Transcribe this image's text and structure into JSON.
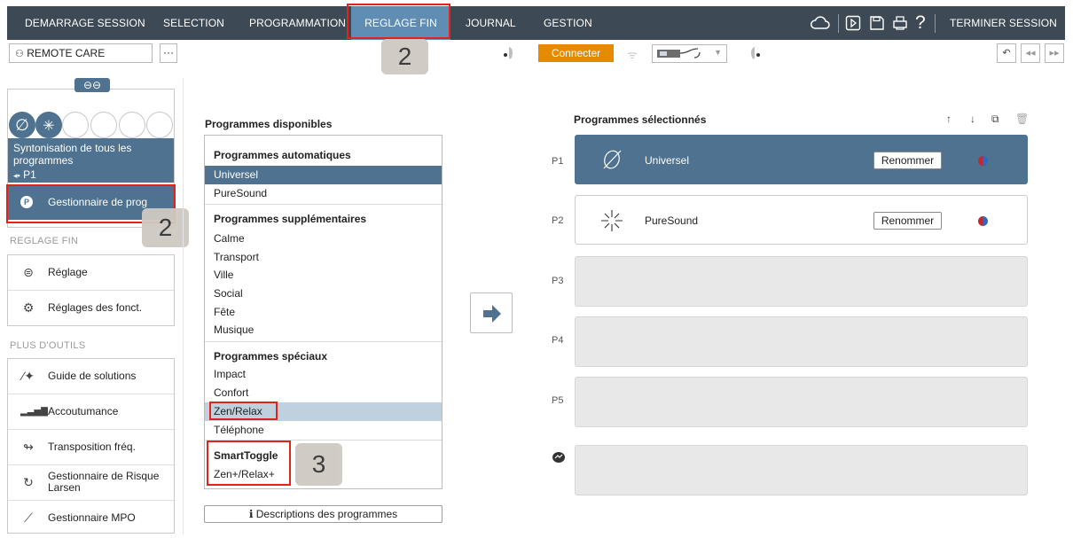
{
  "nav": {
    "items": [
      {
        "label": "DEMARRAGE SESSION"
      },
      {
        "label": "SELECTION"
      },
      {
        "label": "PROGRAMMATION"
      },
      {
        "label": "REGLAGE FIN"
      },
      {
        "label": "JOURNAL"
      },
      {
        "label": "GESTION"
      }
    ],
    "end_session": "TERMINER SESSION",
    "help_glyph": "?"
  },
  "toolbar": {
    "remote_label": "REMOTE CARE",
    "more_glyph": "···",
    "connect_label": "Connecter"
  },
  "badges": {
    "nav": "2",
    "manager": "2",
    "smarttoggle": "3"
  },
  "sidebar": {
    "sync_line1": "Syntonisation de tous les",
    "sync_line2": "programmes",
    "sync_prog": "P1",
    "program_manager": "Gestionnaire de prog",
    "reglage_fin_header": "REGLAGE FIN",
    "reglage_items": [
      {
        "label": "Réglage",
        "icon": "adjust-icon"
      },
      {
        "label": "Réglages des fonct.",
        "icon": "gear-icon"
      }
    ],
    "tools_header": "PLUS D'OUTILS",
    "tools_items": [
      {
        "label": "Guide de solutions",
        "icon": "magic-wand-icon"
      },
      {
        "label": "Accoutumance",
        "icon": "bars-icon"
      },
      {
        "label": "Transposition fréq.",
        "icon": "transposition-icon"
      },
      {
        "label": "Gestionnaire de Risque",
        "label2": "Larsen",
        "icon": "feedback-icon"
      },
      {
        "label": "Gestionnaire MPO",
        "icon": "mpo-icon"
      }
    ]
  },
  "available": {
    "title": "Programmes disponibles",
    "groups": {
      "auto": {
        "header": "Programmes automatiques",
        "items": [
          "Universel",
          "PureSound"
        ]
      },
      "extra": {
        "header": "Programmes supplémentaires",
        "items": [
          "Calme",
          "Transport",
          "Ville",
          "Social",
          "Fête",
          "Musique"
        ]
      },
      "special": {
        "header": "Programmes spéciaux",
        "items": [
          "Impact",
          "Confort",
          "Zen/Relax",
          "Téléphone"
        ]
      },
      "toggle": {
        "header": "SmartToggle",
        "items": [
          "Zen+/Relax+"
        ]
      }
    },
    "descriptions_button": "Descriptions des programmes"
  },
  "selected": {
    "title": "Programmes sélectionnés",
    "rename_label": "Renommer",
    "slots": [
      {
        "label": "P1",
        "name": "Universel"
      },
      {
        "label": "P2",
        "name": "PureSound"
      },
      {
        "label": "P3"
      },
      {
        "label": "P4"
      },
      {
        "label": "P5"
      }
    ]
  },
  "colors": {
    "nav_bg": "#3d4a55",
    "accent": "#4e7290",
    "connect": "#e68a00",
    "highlight": "#e2231a"
  }
}
